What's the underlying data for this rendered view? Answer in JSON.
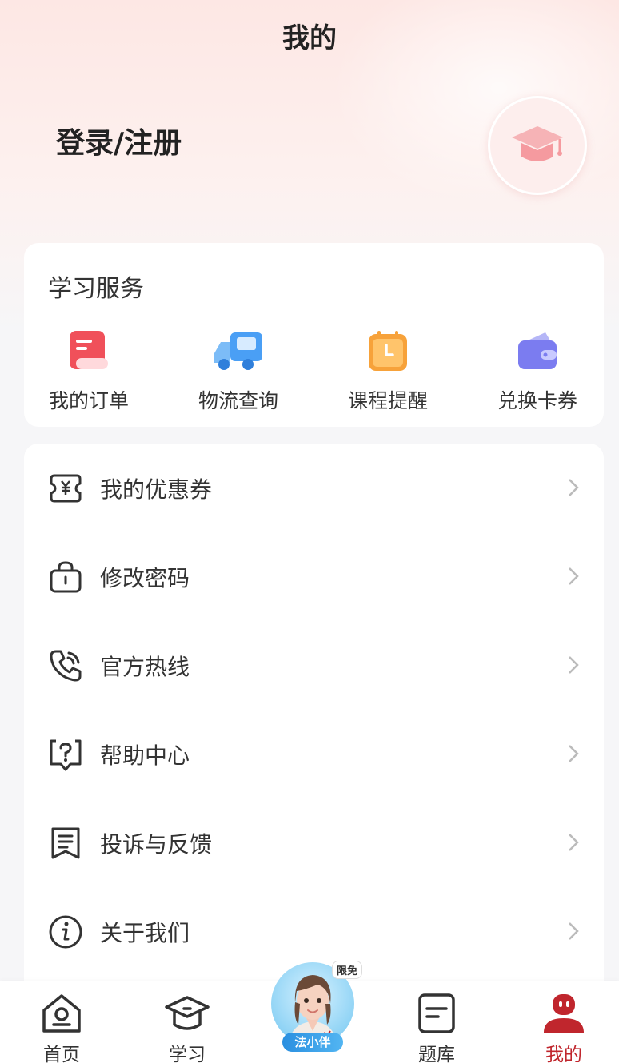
{
  "header": {
    "title": "我的"
  },
  "profile": {
    "login_label": "登录/注册",
    "avatar_icon": "graduation-cap-icon"
  },
  "services": {
    "title": "学习服务",
    "items": [
      {
        "label": "我的订单",
        "icon": "order-icon",
        "color": "#f0505a"
      },
      {
        "label": "物流查询",
        "icon": "truck-icon",
        "color": "#4a9ff5"
      },
      {
        "label": "课程提醒",
        "icon": "calendar-clock-icon",
        "color": "#f7a23a"
      },
      {
        "label": "兑换卡券",
        "icon": "wallet-icon",
        "color": "#7b7cf0"
      }
    ]
  },
  "menu": {
    "items": [
      {
        "label": "我的优惠券",
        "icon": "coupon-icon"
      },
      {
        "label": "修改密码",
        "icon": "lock-bag-icon"
      },
      {
        "label": "官方热线",
        "icon": "phone-icon"
      },
      {
        "label": "帮助中心",
        "icon": "help-icon"
      },
      {
        "label": "投诉与反馈",
        "icon": "feedback-icon"
      },
      {
        "label": "关于我们",
        "icon": "info-icon"
      }
    ]
  },
  "tabbar": {
    "items": [
      {
        "label": "首页",
        "icon": "home-icon",
        "active": false
      },
      {
        "label": "学习",
        "icon": "study-icon",
        "active": false
      },
      {
        "label": "题库",
        "icon": "question-bank-icon",
        "active": false
      },
      {
        "label": "我的",
        "icon": "profile-icon",
        "active": true
      }
    ],
    "ai": {
      "name": "法小伴",
      "badge": "限免"
    }
  },
  "colors": {
    "accent": "#c0262d",
    "text": "#333333",
    "background": "#f6f6f8"
  }
}
